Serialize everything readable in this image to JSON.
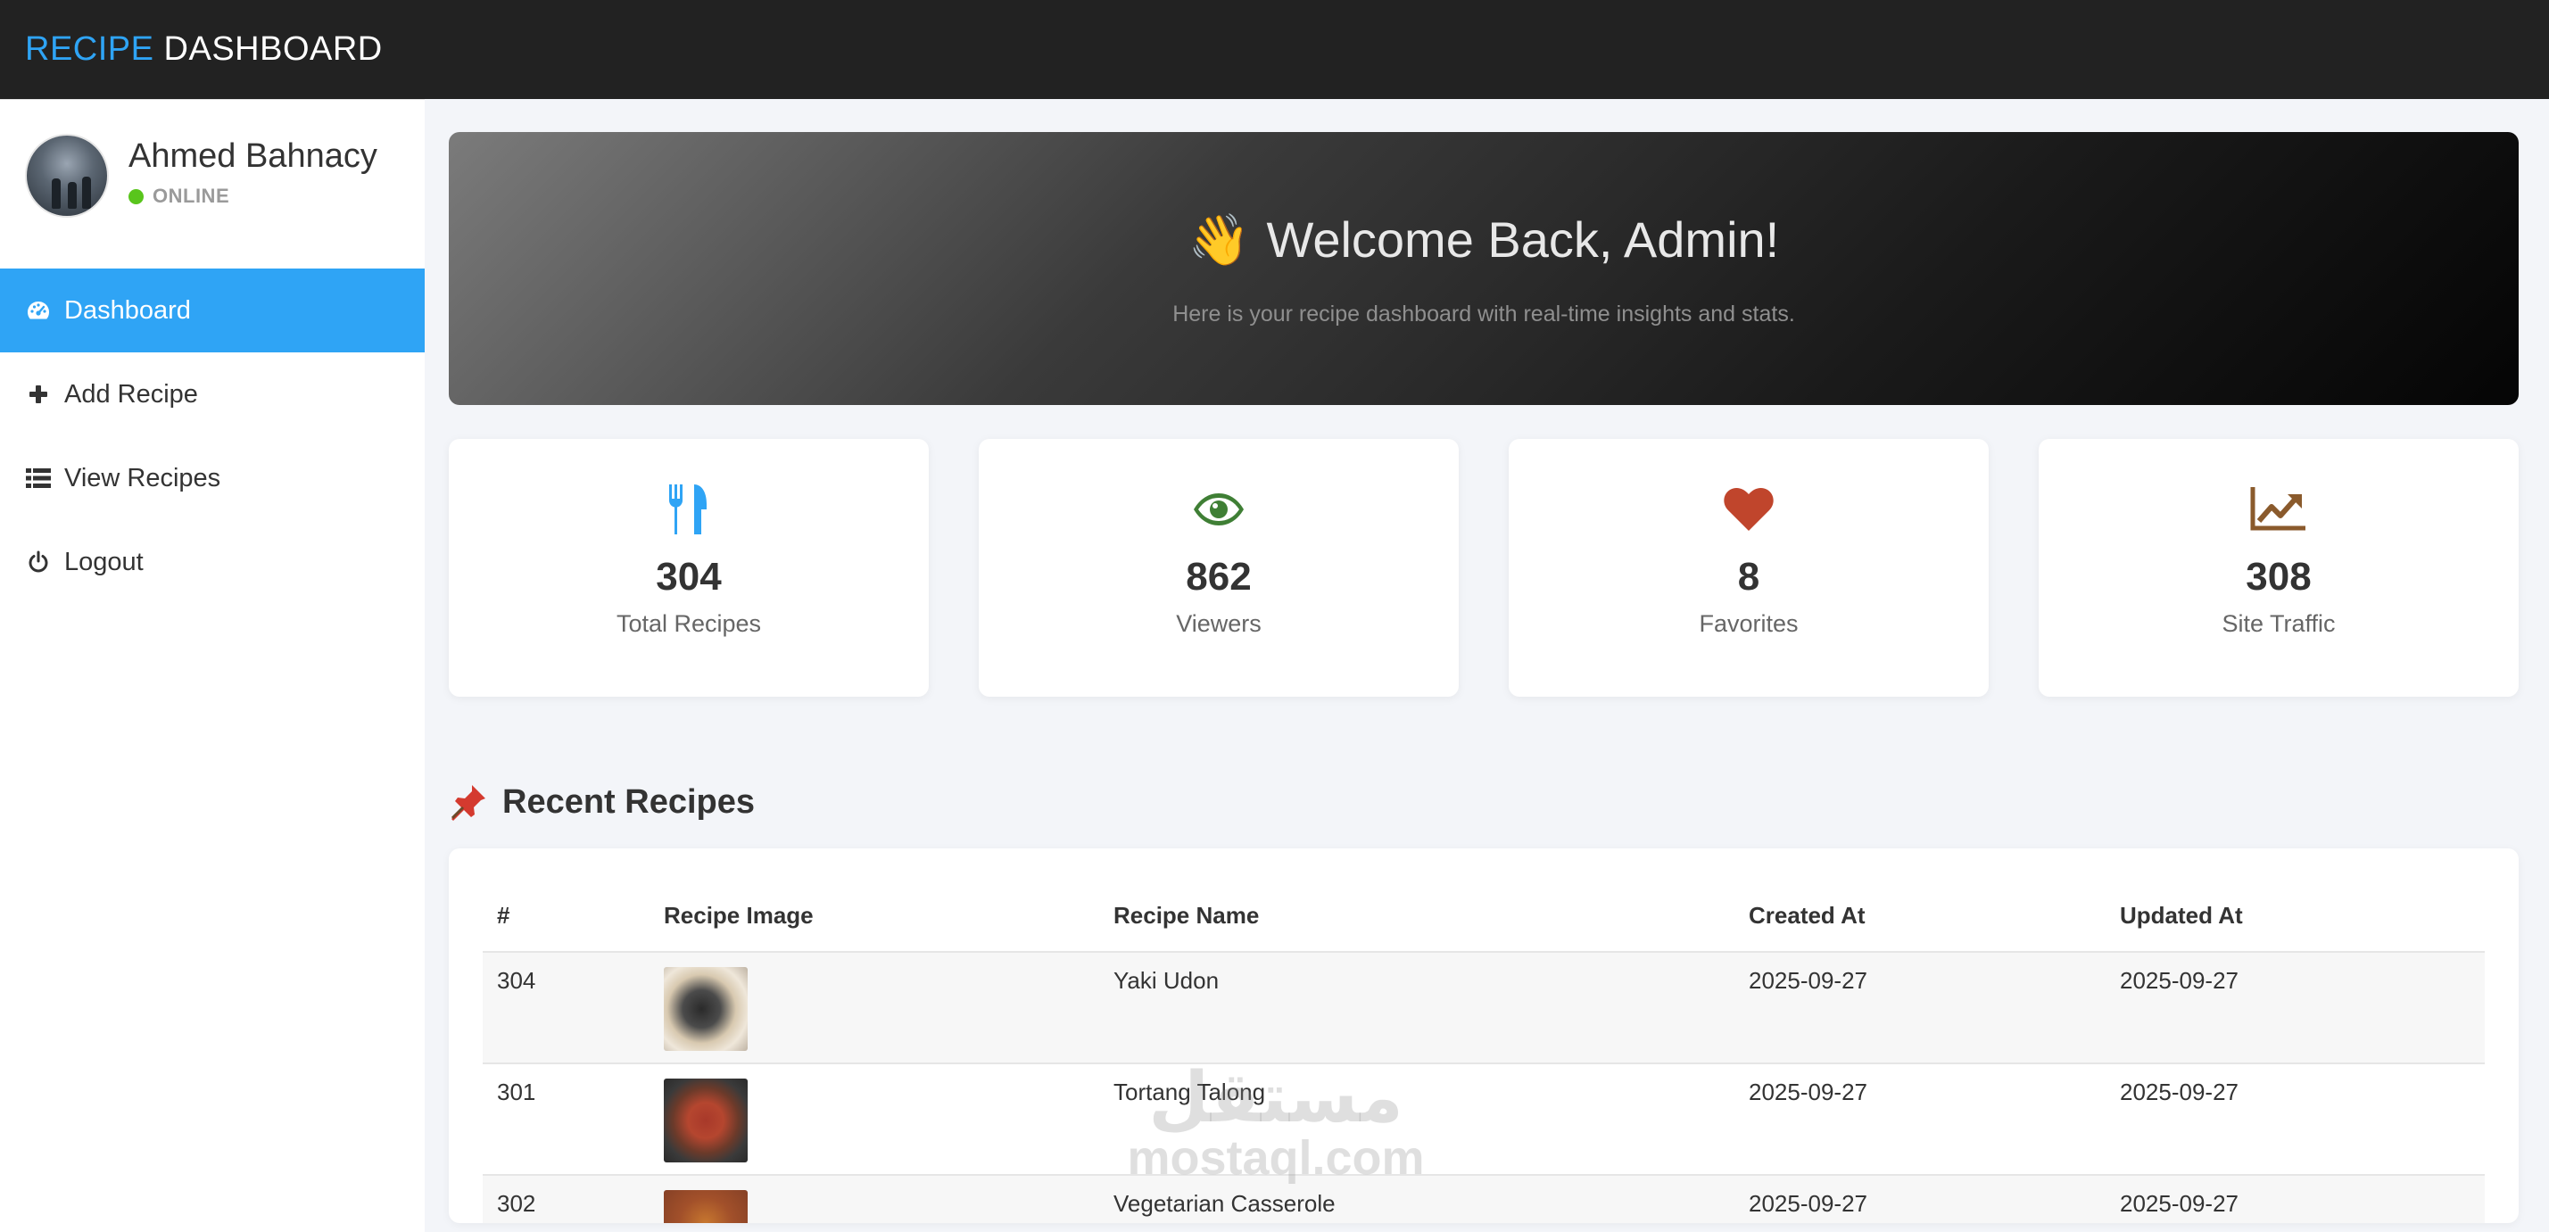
{
  "app": {
    "brand_accent": "RECIPE",
    "brand_rest": " DASHBOARD"
  },
  "colors": {
    "accent": "#2fa4f5",
    "topbar": "#222222",
    "online": "#59c51c",
    "eye": "#3f7f35",
    "heart": "#c0452c",
    "chart": "#8a5a2c"
  },
  "profile": {
    "name": "Ahmed Bahnacy",
    "status": "ONLINE"
  },
  "nav": {
    "items": [
      {
        "label": "Dashboard",
        "icon": "dashboard-gauge-icon"
      },
      {
        "label": "Add Recipe",
        "icon": "plus-icon"
      },
      {
        "label": "View Recipes",
        "icon": "list-icon"
      },
      {
        "label": "Logout",
        "icon": "power-icon"
      }
    ]
  },
  "hero": {
    "emoji": "👋",
    "title": "Welcome Back, Admin!",
    "subtitle": "Here is your recipe dashboard with real-time insights and stats."
  },
  "stats": [
    {
      "value": "304",
      "label": "Total Recipes",
      "icon": "utensils-icon"
    },
    {
      "value": "862",
      "label": "Viewers",
      "icon": "eye-icon"
    },
    {
      "value": "8",
      "label": "Favorites",
      "icon": "heart-icon"
    },
    {
      "value": "308",
      "label": "Site Traffic",
      "icon": "chart-line-icon"
    }
  ],
  "recent": {
    "title": "Recent Recipes",
    "columns": [
      "#",
      "Recipe Image",
      "Recipe Name",
      "Created At",
      "Updated At"
    ],
    "rows": [
      {
        "id": "304",
        "name": "Yaki Udon",
        "created": "2025-09-27",
        "updated": "2025-09-27"
      },
      {
        "id": "301",
        "name": "Tortang Talong",
        "created": "2025-09-27",
        "updated": "2025-09-27"
      },
      {
        "id": "302",
        "name": "Vegetarian Casserole",
        "created": "2025-09-27",
        "updated": "2025-09-27"
      }
    ]
  },
  "watermark": {
    "line1": "مستقل",
    "line2": "mostaql.com"
  }
}
